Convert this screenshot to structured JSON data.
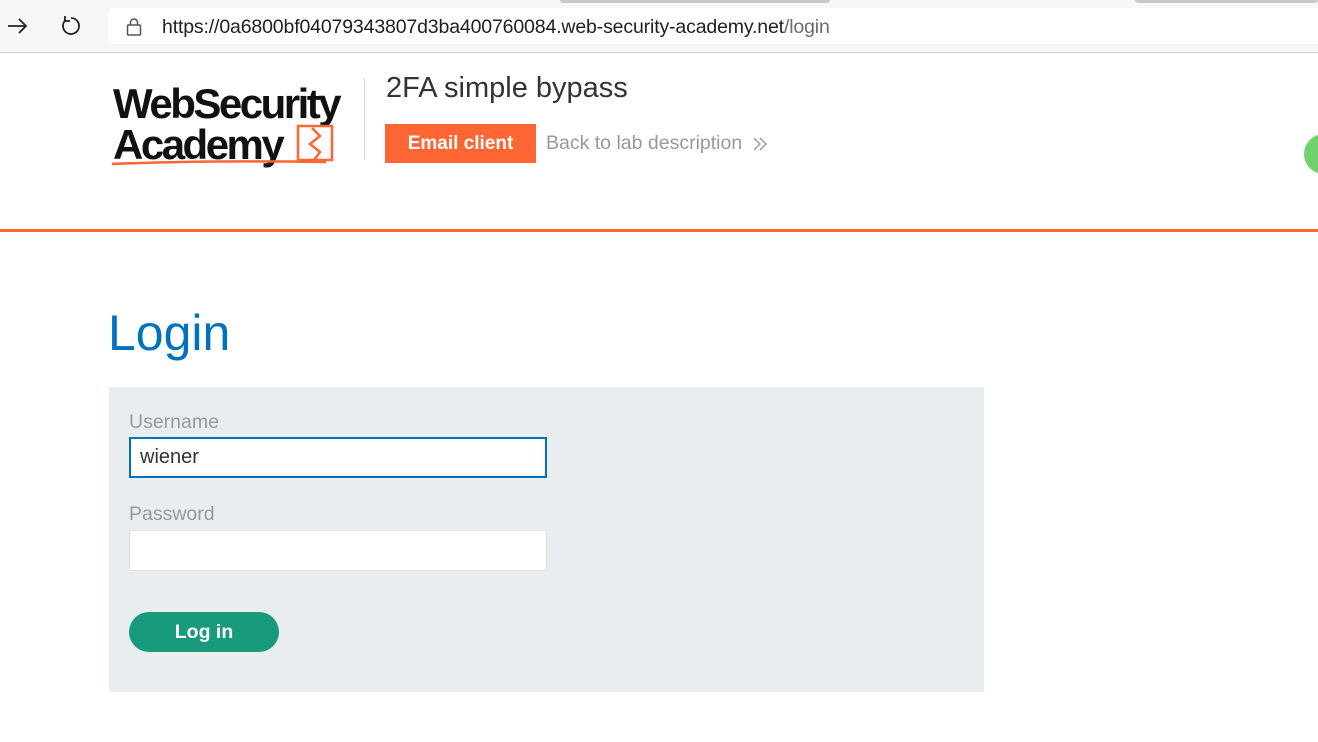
{
  "browser": {
    "url_base": "https://0a6800bf04079343807d3ba400760084.web-security-academy.net",
    "url_path": "/login"
  },
  "header": {
    "logo_line1": "WebSecurity",
    "logo_line2": "Academy",
    "lab_title": "2FA simple bypass",
    "email_client_label": "Email client",
    "back_link_label": "Back to lab description"
  },
  "main": {
    "title": "Login",
    "username_label": "Username",
    "username_value": "wiener",
    "password_label": "Password",
    "password_value": "",
    "login_button_label": "Log in"
  },
  "colors": {
    "brand_orange": "#ff6633",
    "title_blue": "#0071bc",
    "button_green": "#1a9a7d",
    "panel_bg": "#e8eef0"
  }
}
